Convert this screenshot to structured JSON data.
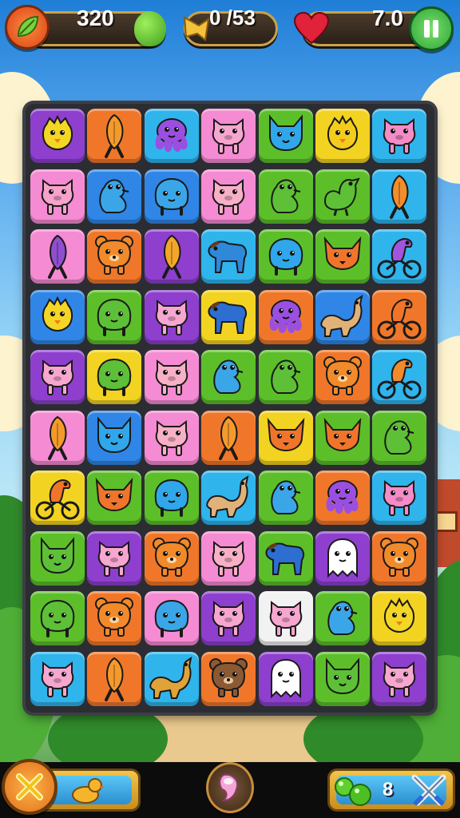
{
  "hud": {
    "score": "320",
    "moves": "0 /53",
    "lives": "7.0",
    "score_icon": "leaf-badge-icon",
    "score_bonus_icon": "green-fruit-icon",
    "moves_icon": "golden-trumpet-icon",
    "lives_icon": "heart-icon",
    "pause_icon": "pause-icon"
  },
  "colors": {
    "yellow": "#f3d321",
    "orange": "#f0772a",
    "cyan": "#2fb4ec",
    "pink": "#f58bd2",
    "green": "#5cbf2a",
    "purple": "#8e3fce",
    "blue": "#2f86e6",
    "white": "#f2f2f2"
  },
  "board": {
    "rows": [
      [
        {
          "bg": "purple",
          "kind": "chick",
          "c": "#f4d624"
        },
        {
          "bg": "orange",
          "kind": "fish",
          "c": "#f49a2c"
        },
        {
          "bg": "cyan",
          "kind": "octopus",
          "c": "#9b4fe0"
        },
        {
          "bg": "pink",
          "kind": "pig",
          "c": "#f7a6cf"
        },
        {
          "bg": "green",
          "kind": "cat",
          "c": "#2fa7ea"
        },
        {
          "bg": "yellow",
          "kind": "chick",
          "c": "#f4cc1c"
        },
        {
          "bg": "cyan",
          "kind": "pig",
          "c": "#f48cc8"
        }
      ],
      [
        {
          "bg": "pink",
          "kind": "pig",
          "c": "#f6a2cb"
        },
        {
          "bg": "blue",
          "kind": "seal",
          "c": "#3aa6e8"
        },
        {
          "bg": "blue",
          "kind": "blob",
          "c": "#3aa6e8"
        },
        {
          "bg": "pink",
          "kind": "pig",
          "c": "#f8b0c6"
        },
        {
          "bg": "green",
          "kind": "seal",
          "c": "#5dc037"
        },
        {
          "bg": "green",
          "kind": "bird",
          "c": "#5dc037"
        },
        {
          "bg": "cyan",
          "kind": "fish",
          "c": "#f28d2b"
        }
      ],
      [
        {
          "bg": "pink",
          "kind": "fish",
          "c": "#8e4fcf"
        },
        {
          "bg": "orange",
          "kind": "bear",
          "c": "#f18a2a"
        },
        {
          "bg": "purple",
          "kind": "fish",
          "c": "#f3a728"
        },
        {
          "bg": "cyan",
          "kind": "horse",
          "c": "#2f88d8"
        },
        {
          "bg": "green",
          "kind": "blob",
          "c": "#2fa7ea"
        },
        {
          "bg": "green",
          "kind": "fox",
          "c": "#f0752a"
        },
        {
          "bg": "cyan",
          "kind": "rider",
          "c": "#a254dc"
        }
      ],
      [
        {
          "bg": "blue",
          "kind": "chick",
          "c": "#f4d624"
        },
        {
          "bg": "green",
          "kind": "blob",
          "c": "#5dc037"
        },
        {
          "bg": "purple",
          "kind": "pig",
          "c": "#f7a6cf"
        },
        {
          "bg": "yellow",
          "kind": "horse",
          "c": "#2d6ed0"
        },
        {
          "bg": "orange",
          "kind": "octopus",
          "c": "#9b4fe0"
        },
        {
          "bg": "blue",
          "kind": "weasel",
          "c": "#e0b27a"
        },
        {
          "bg": "orange",
          "kind": "rider",
          "c": "#f0752a"
        }
      ],
      [
        {
          "bg": "purple",
          "kind": "pig",
          "c": "#f7a6cf"
        },
        {
          "bg": "yellow",
          "kind": "blob",
          "c": "#5dc037"
        },
        {
          "bg": "pink",
          "kind": "pig",
          "c": "#f8b0c6"
        },
        {
          "bg": "green",
          "kind": "seal",
          "c": "#3aa6e8"
        },
        {
          "bg": "green",
          "kind": "seal",
          "c": "#5dc037"
        },
        {
          "bg": "orange",
          "kind": "bear",
          "c": "#f18a2a"
        },
        {
          "bg": "cyan",
          "kind": "rider",
          "c": "#f18a2a"
        }
      ],
      [
        {
          "bg": "pink",
          "kind": "fish",
          "c": "#f49a2c"
        },
        {
          "bg": "blue",
          "kind": "cat",
          "c": "#2fa7ea"
        },
        {
          "bg": "pink",
          "kind": "pig",
          "c": "#f8b0c6"
        },
        {
          "bg": "orange",
          "kind": "fish",
          "c": "#f49a2c"
        },
        {
          "bg": "yellow",
          "kind": "fox",
          "c": "#f0752a"
        },
        {
          "bg": "green",
          "kind": "fox",
          "c": "#f0752a"
        },
        {
          "bg": "green",
          "kind": "seal",
          "c": "#5dc037"
        }
      ],
      [
        {
          "bg": "yellow",
          "kind": "rider",
          "c": "#f0752a"
        },
        {
          "bg": "green",
          "kind": "fox",
          "c": "#f0752a"
        },
        {
          "bg": "green",
          "kind": "blob",
          "c": "#2fa7ea"
        },
        {
          "bg": "cyan",
          "kind": "weasel",
          "c": "#e0b27a"
        },
        {
          "bg": "green",
          "kind": "seal",
          "c": "#3aa6e8"
        },
        {
          "bg": "orange",
          "kind": "octopus",
          "c": "#9b4fe0"
        },
        {
          "bg": "cyan",
          "kind": "pig",
          "c": "#f48cc8"
        }
      ],
      [
        {
          "bg": "green",
          "kind": "cat",
          "c": "#5dc037"
        },
        {
          "bg": "purple",
          "kind": "pig",
          "c": "#f7a6cf"
        },
        {
          "bg": "orange",
          "kind": "bear",
          "c": "#f18a2a"
        },
        {
          "bg": "pink",
          "kind": "pig",
          "c": "#f8b0c6"
        },
        {
          "bg": "green",
          "kind": "horse",
          "c": "#2d6ed0"
        },
        {
          "bg": "purple",
          "kind": "ghost",
          "c": "#ffffff"
        },
        {
          "bg": "orange",
          "kind": "bear",
          "c": "#f18a2a"
        }
      ],
      [
        {
          "bg": "green",
          "kind": "blob",
          "c": "#5dc037"
        },
        {
          "bg": "orange",
          "kind": "bear",
          "c": "#f18a2a"
        },
        {
          "bg": "pink",
          "kind": "blob",
          "c": "#3aa6e8"
        },
        {
          "bg": "purple",
          "kind": "pig",
          "c": "#f7a6cf"
        },
        {
          "bg": "white",
          "kind": "pig",
          "c": "#f7a6cf"
        },
        {
          "bg": "green",
          "kind": "seal",
          "c": "#3aa6e8"
        },
        {
          "bg": "yellow",
          "kind": "chick",
          "c": "#f4d624"
        }
      ],
      [
        {
          "bg": "cyan",
          "kind": "pig",
          "c": "#f7a6cf"
        },
        {
          "bg": "orange",
          "kind": "fish",
          "c": "#f49a2c"
        },
        {
          "bg": "cyan",
          "kind": "weasel",
          "c": "#e0a33a"
        },
        {
          "bg": "orange",
          "kind": "bear",
          "c": "#8a5a35"
        },
        {
          "bg": "purple",
          "kind": "ghost",
          "c": "#ffffff"
        },
        {
          "bg": "green",
          "kind": "cat",
          "c": "#5dc037"
        },
        {
          "bg": "purple",
          "kind": "pig",
          "c": "#f7a6cf"
        }
      ]
    ]
  },
  "bottom": {
    "cancel_icon": "close-x-icon",
    "duck_icon": "duck-icon",
    "center_icon": "shell-booster-icon",
    "green_orbs_icon": "green-orbs-icon",
    "powerup_count": "8",
    "swords_icon": "crossed-swords-icon"
  }
}
